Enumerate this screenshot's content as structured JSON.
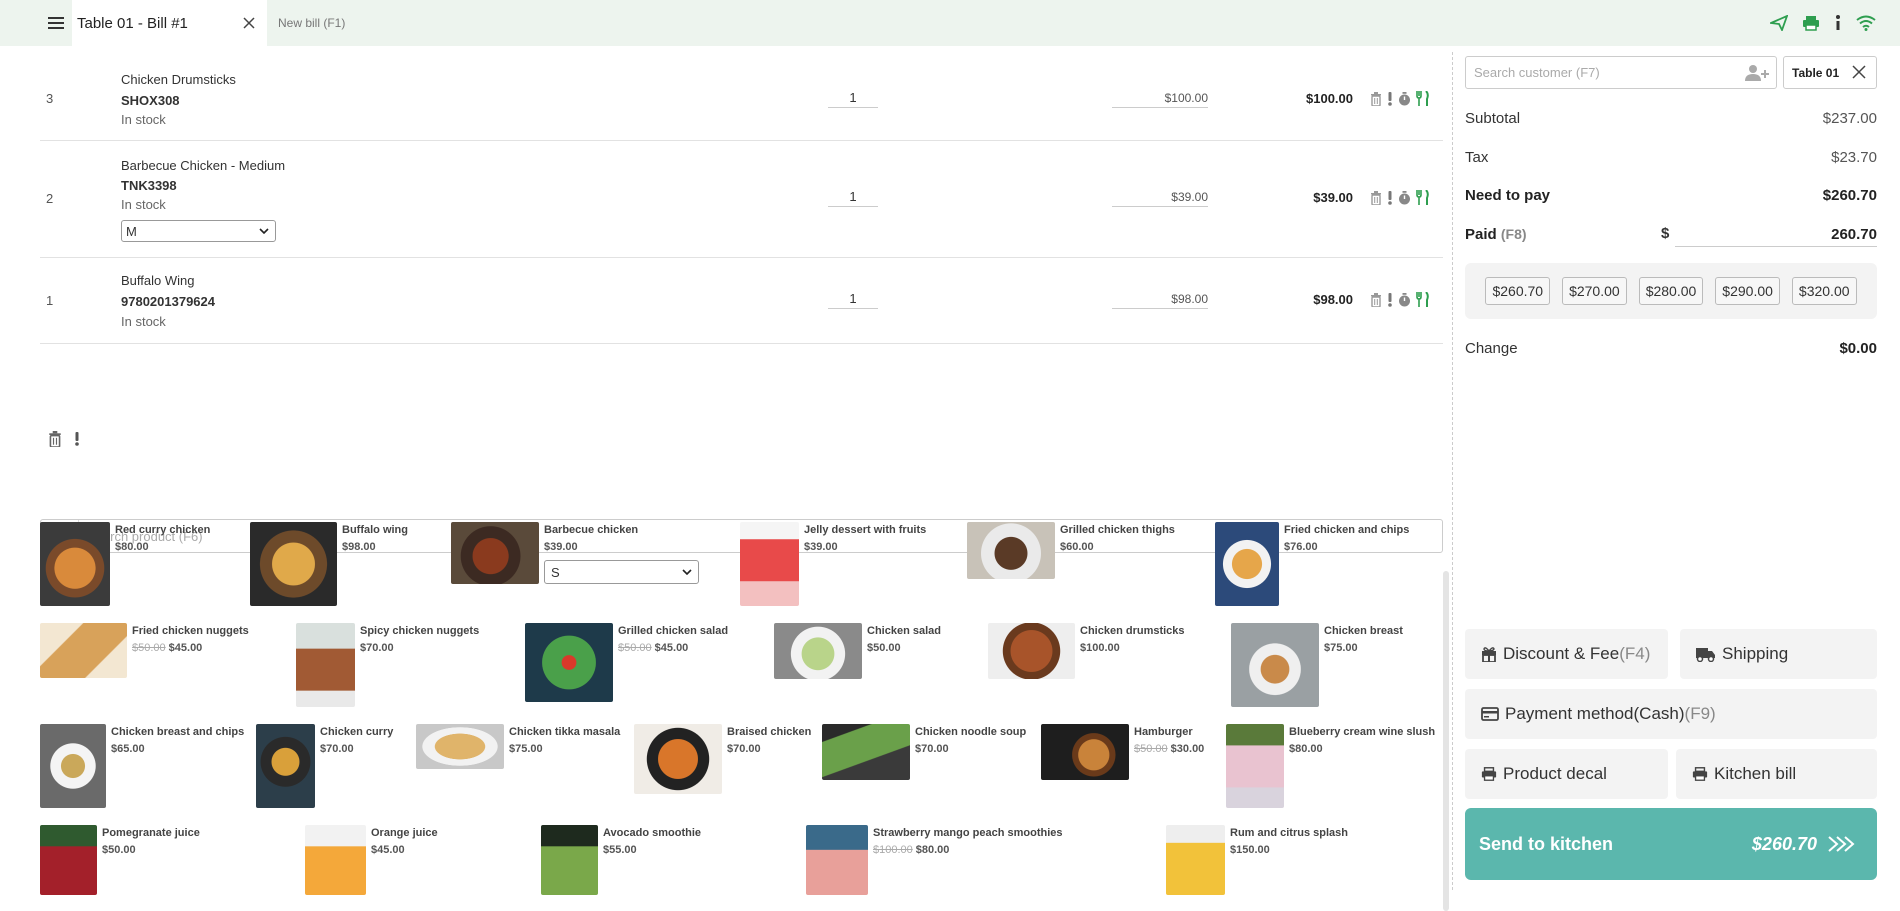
{
  "tabs": {
    "active": "Table 01 - Bill #1",
    "new": "New bill (F1)"
  },
  "lines": [
    {
      "idx": "3",
      "name": "Chicken Drumsticks",
      "sku": "SHOX308",
      "stock": "In stock",
      "qty": "1",
      "price": "$100.00",
      "total": "$100.00"
    },
    {
      "idx": "2",
      "name": "Barbecue Chicken - Medium",
      "sku": "TNK3398",
      "stock": "In stock",
      "size": "M",
      "qty": "1",
      "price": "$39.00",
      "total": "$39.00"
    },
    {
      "idx": "1",
      "name": "Buffalo Wing",
      "sku": "9780201379624",
      "stock": "In stock",
      "qty": "1",
      "price": "$98.00",
      "total": "$98.00"
    }
  ],
  "search_product": {
    "placeholder": "Search product (F6)"
  },
  "products": [
    {
      "name": "Red curry chicken",
      "price": "$80.00"
    },
    {
      "name": "Buffalo wing",
      "price": "$98.00"
    },
    {
      "name": "Barbecue chicken",
      "price": "$39.00",
      "size": "S"
    },
    {
      "name": "Jelly dessert with fruits",
      "price": "$39.00"
    },
    {
      "name": "Grilled chicken thighs",
      "price": "$60.00"
    },
    {
      "name": "Fried chicken and chips",
      "price": "$76.00"
    },
    {
      "name": "Fried chicken nuggets",
      "old": "$50.00",
      "price": "$45.00"
    },
    {
      "name": "Spicy chicken nuggets",
      "price": "$70.00"
    },
    {
      "name": "Grilled chicken salad",
      "old": "$50.00",
      "price": "$45.00"
    },
    {
      "name": "Chicken salad",
      "price": "$50.00"
    },
    {
      "name": "Chicken drumsticks",
      "price": "$100.00"
    },
    {
      "name": "Chicken breast",
      "price": "$75.00"
    },
    {
      "name": "Chicken breast and chips",
      "price": "$65.00"
    },
    {
      "name": "Chicken curry",
      "price": "$70.00"
    },
    {
      "name": "Chicken tikka masala",
      "price": "$75.00"
    },
    {
      "name": "Braised chicken",
      "price": "$70.00"
    },
    {
      "name": "Chicken noodle soup",
      "price": "$70.00"
    },
    {
      "name": "Hamburger",
      "old": "$50.00",
      "price": "$30.00"
    },
    {
      "name": "Blueberry cream wine slush",
      "price": "$80.00"
    },
    {
      "name": "Pomegranate juice",
      "price": "$50.00"
    },
    {
      "name": "Orange juice",
      "price": "$45.00"
    },
    {
      "name": "Avocado smoothie",
      "price": "$55.00"
    },
    {
      "name": "Strawberry mango peach smoothies",
      "old": "$100.00",
      "price": "$80.00"
    },
    {
      "name": "Rum and citrus splash",
      "price": "$150.00"
    }
  ],
  "customer": {
    "placeholder": "Search customer (F7)",
    "table": "Table 01"
  },
  "summary": {
    "subtotal_label": "Subtotal",
    "subtotal": "$237.00",
    "tax_label": "Tax",
    "tax": "$23.70",
    "need_label": "Need to pay",
    "need": "$260.70",
    "paid_label": "Paid",
    "paid_hint": "(F8)",
    "currency": "$",
    "paid": "260.70",
    "change_label": "Change",
    "change": "$0.00"
  },
  "quick_amounts": [
    "$260.70",
    "$270.00",
    "$280.00",
    "$290.00",
    "$320.00"
  ],
  "actions": {
    "discount": "Discount & Fee",
    "discount_hint": "(F4)",
    "shipping": "Shipping",
    "payment": "Payment method(Cash)",
    "payment_hint": "(F9)",
    "decal": "Product decal",
    "kitchen": "Kitchen bill",
    "send": "Send to kitchen",
    "send_amount": "$260.70"
  },
  "colors": {
    "accent": "#5bb7ad",
    "green_icon": "#2e9e4f",
    "topbar": "#edf4ee"
  }
}
